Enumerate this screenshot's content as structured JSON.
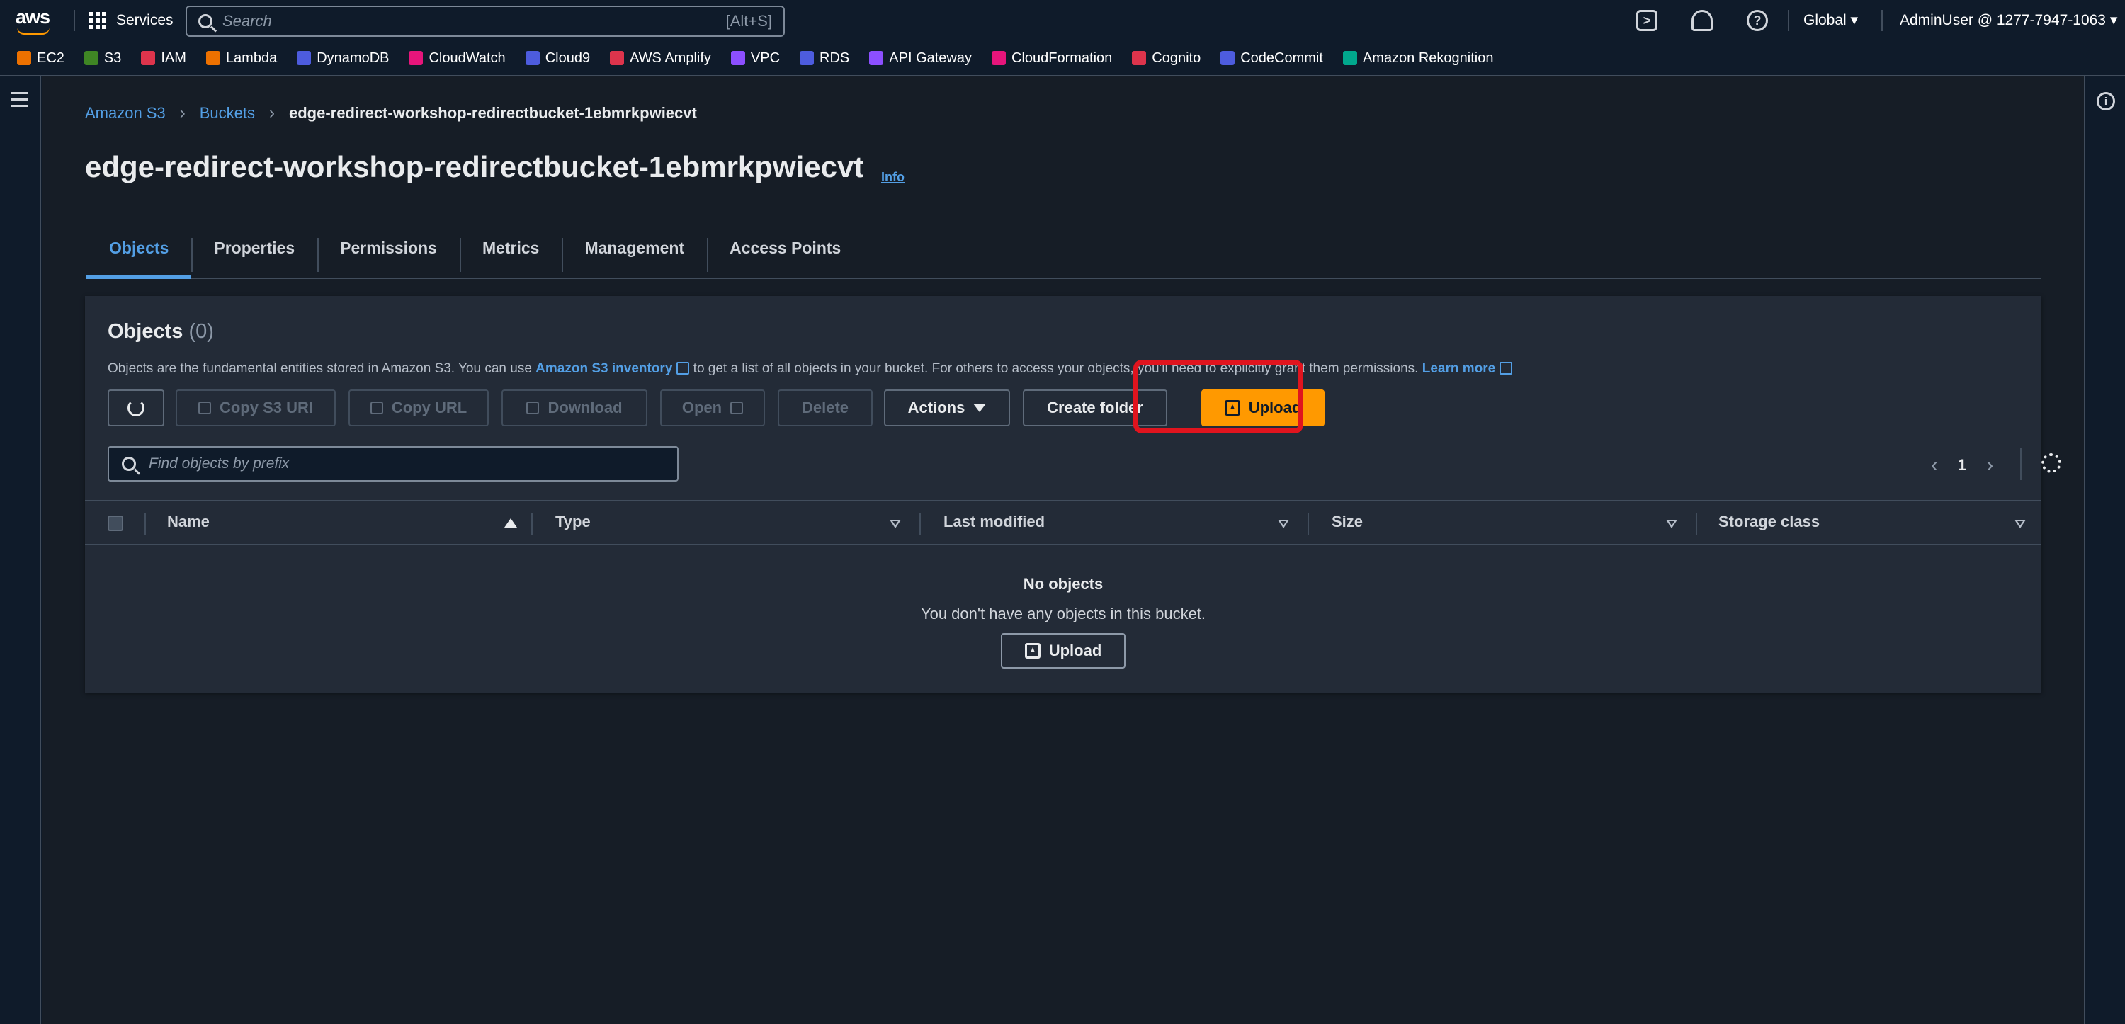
{
  "topnav": {
    "logo": "aws",
    "services_label": "Services",
    "search_placeholder": "Search",
    "search_shortcut": "[Alt+S]",
    "region": "Global ▾",
    "user": "AdminUser @ 1277-7947-1063 ▾",
    "icons": [
      "cloudshell-icon",
      "notifications-icon",
      "help-icon"
    ]
  },
  "favorites": [
    {
      "label": "EC2",
      "color": "#ed7100"
    },
    {
      "label": "S3",
      "color": "#3f8624"
    },
    {
      "label": "IAM",
      "color": "#dd344c"
    },
    {
      "label": "Lambda",
      "color": "#ed7100"
    },
    {
      "label": "DynamoDB",
      "color": "#4d5cde"
    },
    {
      "label": "CloudWatch",
      "color": "#e7157b"
    },
    {
      "label": "Cloud9",
      "color": "#4d5cde"
    },
    {
      "label": "AWS Amplify",
      "color": "#dd344c"
    },
    {
      "label": "VPC",
      "color": "#8c4fff"
    },
    {
      "label": "RDS",
      "color": "#4d5cde"
    },
    {
      "label": "API Gateway",
      "color": "#8c4fff"
    },
    {
      "label": "CloudFormation",
      "color": "#e7157b"
    },
    {
      "label": "Cognito",
      "color": "#dd344c"
    },
    {
      "label": "CodeCommit",
      "color": "#4d5cde"
    },
    {
      "label": "Amazon Rekognition",
      "color": "#01a88d"
    }
  ],
  "breadcrumb": {
    "root": "Amazon S3",
    "buckets": "Buckets",
    "current": "edge-redirect-workshop-redirectbucket-1ebmrkpwiecvt"
  },
  "page": {
    "title": "edge-redirect-workshop-redirectbucket-1ebmrkpwiecvt",
    "info": "Info"
  },
  "tabs": [
    "Objects",
    "Properties",
    "Permissions",
    "Metrics",
    "Management",
    "Access Points"
  ],
  "objects": {
    "title": "Objects",
    "count": "(0)",
    "desc_1": "Objects are the fundamental entities stored in Amazon S3. You can use ",
    "desc_link": "Amazon S3 inventory",
    "desc_2": " to get a list of all objects in your bucket. For others to access your objects, you'll need to explicitly grant them permissions. ",
    "learn_more": "Learn more",
    "buttons": {
      "copy_uri": "Copy S3 URI",
      "copy_url": "Copy URL",
      "download": "Download",
      "open": "Open",
      "delete": "Delete",
      "actions": "Actions",
      "create_folder": "Create folder",
      "upload": "Upload"
    },
    "filter_placeholder": "Find objects by prefix",
    "page_number": "1",
    "columns": [
      "Name",
      "Type",
      "Last modified",
      "Size",
      "Storage class"
    ],
    "empty_title": "No objects",
    "empty_sub": "You don't have any objects in this bucket.",
    "empty_upload": "Upload"
  },
  "colors": {
    "accent": "#539fe5",
    "primary": "#ff9900",
    "highlight": "#e0141e"
  }
}
